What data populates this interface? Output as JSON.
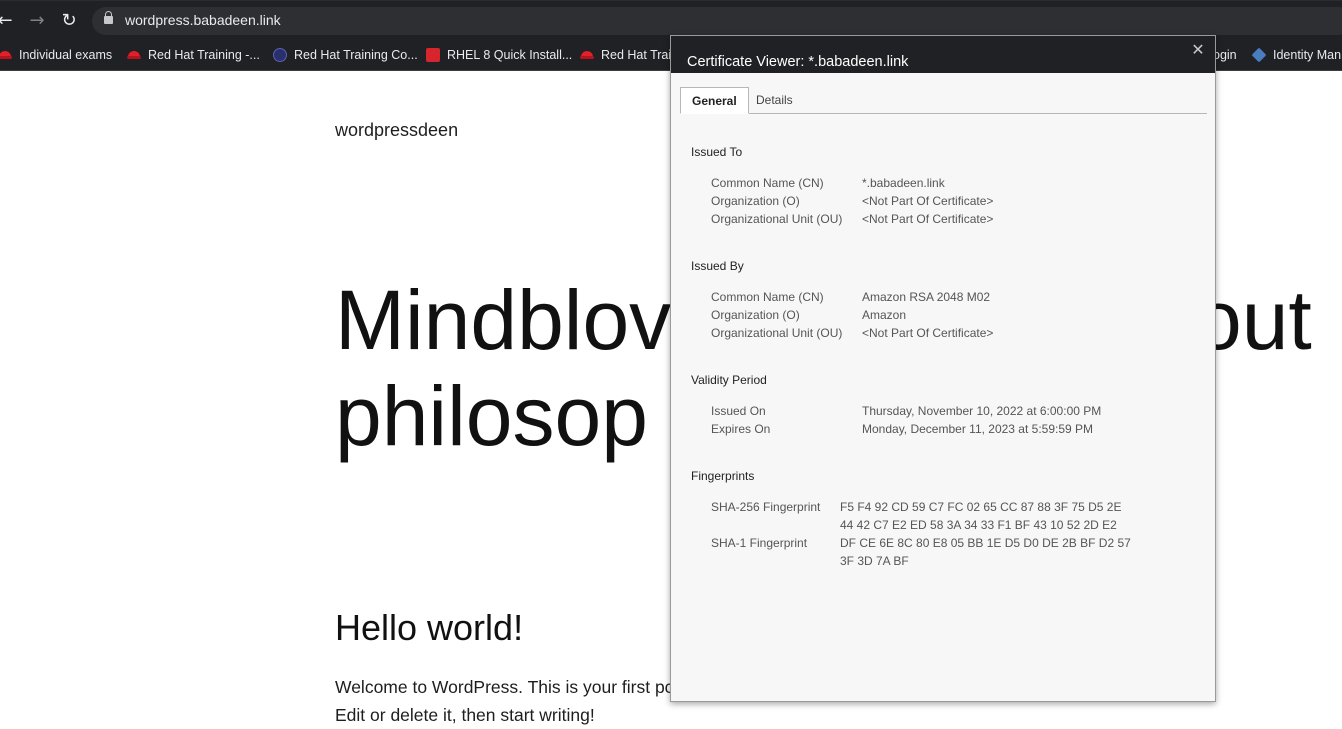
{
  "browser": {
    "url": "wordpress.babadeen.link",
    "bookmarks": [
      {
        "label": "Individual exams",
        "icon": "redhat-icon"
      },
      {
        "label": "Red Hat Training -...",
        "icon": "redhat-icon"
      },
      {
        "label": "Red Hat Training Co...",
        "icon": "training-badge-icon"
      },
      {
        "label": "RHEL 8 Quick Install...",
        "icon": "rhel-icon"
      },
      {
        "label": "Red Hat Trair",
        "icon": "redhat-icon"
      },
      {
        "label": "ogin",
        "icon": ""
      },
      {
        "label": "Identity Man",
        "icon": "cube-icon"
      }
    ]
  },
  "page": {
    "site_title": "wordpressdeen",
    "headline_line1": "Mindblov",
    "headline_line1_end": "out",
    "headline_line2": "philosop",
    "post_title": "Hello world!",
    "post_line1": "Welcome to WordPress. This is your first pc",
    "post_line2": "Edit or delete it, then start writing!"
  },
  "dialog": {
    "title": "Certificate Viewer: *.babadeen.link",
    "close_glyph": "✕",
    "tabs": [
      "General",
      "Details"
    ],
    "issued_to": {
      "heading": "Issued To",
      "rows": [
        {
          "k": "Common Name (CN)",
          "v": "*.babadeen.link"
        },
        {
          "k": "Organization (O)",
          "v": "<Not Part Of Certificate>"
        },
        {
          "k": "Organizational Unit (OU)",
          "v": "<Not Part Of Certificate>"
        }
      ]
    },
    "issued_by": {
      "heading": "Issued By",
      "rows": [
        {
          "k": "Common Name (CN)",
          "v": "Amazon RSA 2048 M02"
        },
        {
          "k": "Organization (O)",
          "v": "Amazon"
        },
        {
          "k": "Organizational Unit (OU)",
          "v": "<Not Part Of Certificate>"
        }
      ]
    },
    "validity": {
      "heading": "Validity Period",
      "rows": [
        {
          "k": "Issued On",
          "v": "Thursday, November 10, 2022 at 6:00:00 PM"
        },
        {
          "k": "Expires On",
          "v": "Monday, December 11, 2023 at 5:59:59 PM"
        }
      ]
    },
    "fingerprints": {
      "heading": "Fingerprints",
      "sha256_label": "SHA-256 Fingerprint",
      "sha256_line1": "F5 F4 92 CD 59 C7 FC 02 65 CC 87 88 3F 75 D5 2E",
      "sha256_line2": "44 42 C7 E2 ED 58 3A 34 33 F1 BF 43 10 52 2D E2",
      "sha1_label": "SHA-1 Fingerprint",
      "sha1_line1": "DF CE 6E 8C 80 E8 05 BB 1E D5 D0 DE 2B BF D2 57",
      "sha1_line2": "3F 3D 7A BF"
    }
  },
  "colors": {
    "chrome_bg": "#202124",
    "omnibox_bg": "#2e2f33",
    "dialog_bg": "#f7f7f7"
  }
}
